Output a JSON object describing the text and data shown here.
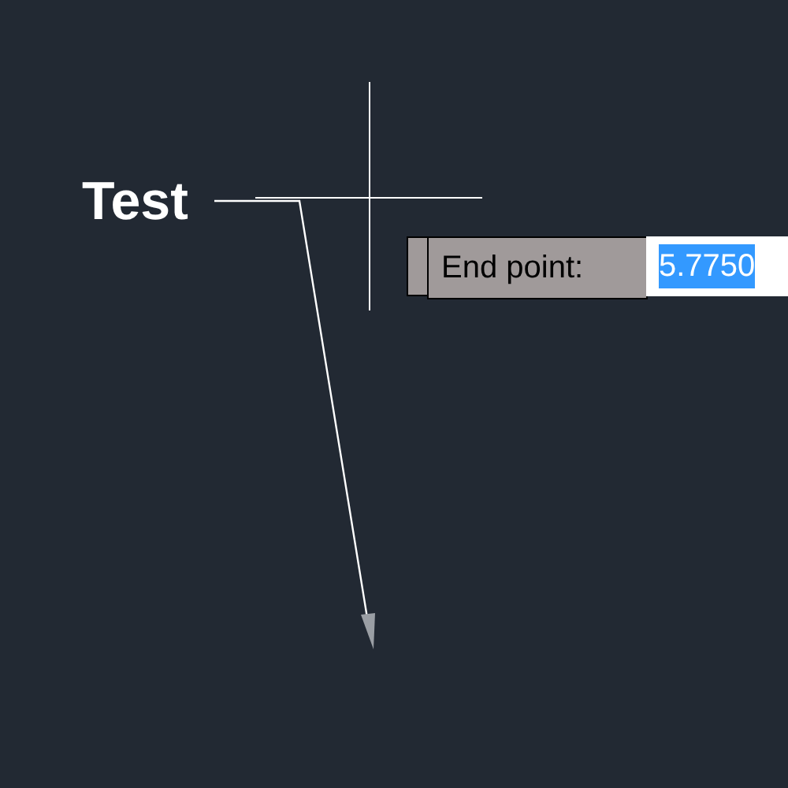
{
  "leader": {
    "text": "Test"
  },
  "input_tooltip": {
    "label": "End point:",
    "value": "5.7750",
    "value_selected": true
  }
}
